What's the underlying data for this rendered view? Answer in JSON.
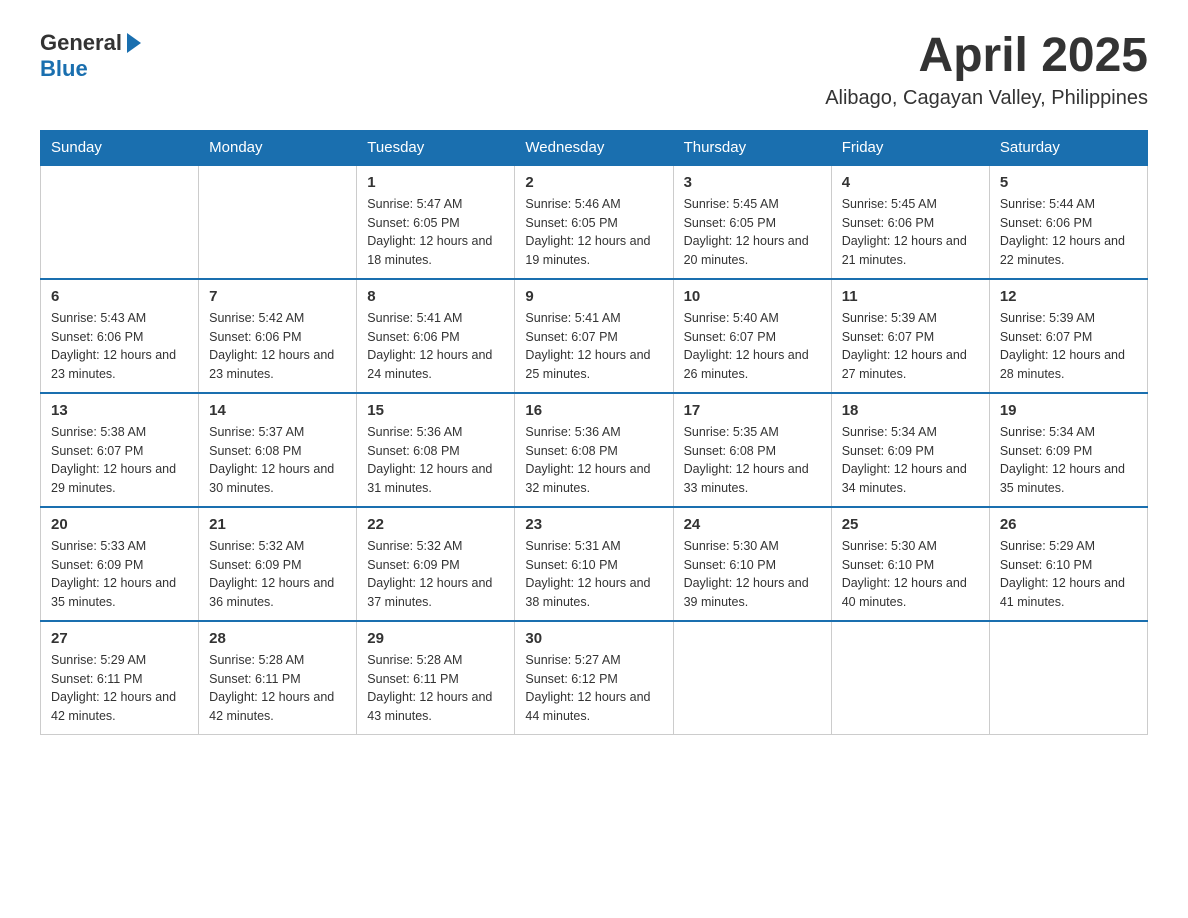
{
  "logo": {
    "text_general": "General",
    "text_blue": "Blue"
  },
  "title": "April 2025",
  "subtitle": "Alibago, Cagayan Valley, Philippines",
  "weekdays": [
    "Sunday",
    "Monday",
    "Tuesday",
    "Wednesday",
    "Thursday",
    "Friday",
    "Saturday"
  ],
  "weeks": [
    [
      {
        "date": "",
        "sunrise": "",
        "sunset": "",
        "daylight": ""
      },
      {
        "date": "",
        "sunrise": "",
        "sunset": "",
        "daylight": ""
      },
      {
        "date": "1",
        "sunrise": "Sunrise: 5:47 AM",
        "sunset": "Sunset: 6:05 PM",
        "daylight": "Daylight: 12 hours and 18 minutes."
      },
      {
        "date": "2",
        "sunrise": "Sunrise: 5:46 AM",
        "sunset": "Sunset: 6:05 PM",
        "daylight": "Daylight: 12 hours and 19 minutes."
      },
      {
        "date": "3",
        "sunrise": "Sunrise: 5:45 AM",
        "sunset": "Sunset: 6:05 PM",
        "daylight": "Daylight: 12 hours and 20 minutes."
      },
      {
        "date": "4",
        "sunrise": "Sunrise: 5:45 AM",
        "sunset": "Sunset: 6:06 PM",
        "daylight": "Daylight: 12 hours and 21 minutes."
      },
      {
        "date": "5",
        "sunrise": "Sunrise: 5:44 AM",
        "sunset": "Sunset: 6:06 PM",
        "daylight": "Daylight: 12 hours and 22 minutes."
      }
    ],
    [
      {
        "date": "6",
        "sunrise": "Sunrise: 5:43 AM",
        "sunset": "Sunset: 6:06 PM",
        "daylight": "Daylight: 12 hours and 23 minutes."
      },
      {
        "date": "7",
        "sunrise": "Sunrise: 5:42 AM",
        "sunset": "Sunset: 6:06 PM",
        "daylight": "Daylight: 12 hours and 23 minutes."
      },
      {
        "date": "8",
        "sunrise": "Sunrise: 5:41 AM",
        "sunset": "Sunset: 6:06 PM",
        "daylight": "Daylight: 12 hours and 24 minutes."
      },
      {
        "date": "9",
        "sunrise": "Sunrise: 5:41 AM",
        "sunset": "Sunset: 6:07 PM",
        "daylight": "Daylight: 12 hours and 25 minutes."
      },
      {
        "date": "10",
        "sunrise": "Sunrise: 5:40 AM",
        "sunset": "Sunset: 6:07 PM",
        "daylight": "Daylight: 12 hours and 26 minutes."
      },
      {
        "date": "11",
        "sunrise": "Sunrise: 5:39 AM",
        "sunset": "Sunset: 6:07 PM",
        "daylight": "Daylight: 12 hours and 27 minutes."
      },
      {
        "date": "12",
        "sunrise": "Sunrise: 5:39 AM",
        "sunset": "Sunset: 6:07 PM",
        "daylight": "Daylight: 12 hours and 28 minutes."
      }
    ],
    [
      {
        "date": "13",
        "sunrise": "Sunrise: 5:38 AM",
        "sunset": "Sunset: 6:07 PM",
        "daylight": "Daylight: 12 hours and 29 minutes."
      },
      {
        "date": "14",
        "sunrise": "Sunrise: 5:37 AM",
        "sunset": "Sunset: 6:08 PM",
        "daylight": "Daylight: 12 hours and 30 minutes."
      },
      {
        "date": "15",
        "sunrise": "Sunrise: 5:36 AM",
        "sunset": "Sunset: 6:08 PM",
        "daylight": "Daylight: 12 hours and 31 minutes."
      },
      {
        "date": "16",
        "sunrise": "Sunrise: 5:36 AM",
        "sunset": "Sunset: 6:08 PM",
        "daylight": "Daylight: 12 hours and 32 minutes."
      },
      {
        "date": "17",
        "sunrise": "Sunrise: 5:35 AM",
        "sunset": "Sunset: 6:08 PM",
        "daylight": "Daylight: 12 hours and 33 minutes."
      },
      {
        "date": "18",
        "sunrise": "Sunrise: 5:34 AM",
        "sunset": "Sunset: 6:09 PM",
        "daylight": "Daylight: 12 hours and 34 minutes."
      },
      {
        "date": "19",
        "sunrise": "Sunrise: 5:34 AM",
        "sunset": "Sunset: 6:09 PM",
        "daylight": "Daylight: 12 hours and 35 minutes."
      }
    ],
    [
      {
        "date": "20",
        "sunrise": "Sunrise: 5:33 AM",
        "sunset": "Sunset: 6:09 PM",
        "daylight": "Daylight: 12 hours and 35 minutes."
      },
      {
        "date": "21",
        "sunrise": "Sunrise: 5:32 AM",
        "sunset": "Sunset: 6:09 PM",
        "daylight": "Daylight: 12 hours and 36 minutes."
      },
      {
        "date": "22",
        "sunrise": "Sunrise: 5:32 AM",
        "sunset": "Sunset: 6:09 PM",
        "daylight": "Daylight: 12 hours and 37 minutes."
      },
      {
        "date": "23",
        "sunrise": "Sunrise: 5:31 AM",
        "sunset": "Sunset: 6:10 PM",
        "daylight": "Daylight: 12 hours and 38 minutes."
      },
      {
        "date": "24",
        "sunrise": "Sunrise: 5:30 AM",
        "sunset": "Sunset: 6:10 PM",
        "daylight": "Daylight: 12 hours and 39 minutes."
      },
      {
        "date": "25",
        "sunrise": "Sunrise: 5:30 AM",
        "sunset": "Sunset: 6:10 PM",
        "daylight": "Daylight: 12 hours and 40 minutes."
      },
      {
        "date": "26",
        "sunrise": "Sunrise: 5:29 AM",
        "sunset": "Sunset: 6:10 PM",
        "daylight": "Daylight: 12 hours and 41 minutes."
      }
    ],
    [
      {
        "date": "27",
        "sunrise": "Sunrise: 5:29 AM",
        "sunset": "Sunset: 6:11 PM",
        "daylight": "Daylight: 12 hours and 42 minutes."
      },
      {
        "date": "28",
        "sunrise": "Sunrise: 5:28 AM",
        "sunset": "Sunset: 6:11 PM",
        "daylight": "Daylight: 12 hours and 42 minutes."
      },
      {
        "date": "29",
        "sunrise": "Sunrise: 5:28 AM",
        "sunset": "Sunset: 6:11 PM",
        "daylight": "Daylight: 12 hours and 43 minutes."
      },
      {
        "date": "30",
        "sunrise": "Sunrise: 5:27 AM",
        "sunset": "Sunset: 6:12 PM",
        "daylight": "Daylight: 12 hours and 44 minutes."
      },
      {
        "date": "",
        "sunrise": "",
        "sunset": "",
        "daylight": ""
      },
      {
        "date": "",
        "sunrise": "",
        "sunset": "",
        "daylight": ""
      },
      {
        "date": "",
        "sunrise": "",
        "sunset": "",
        "daylight": ""
      }
    ]
  ]
}
